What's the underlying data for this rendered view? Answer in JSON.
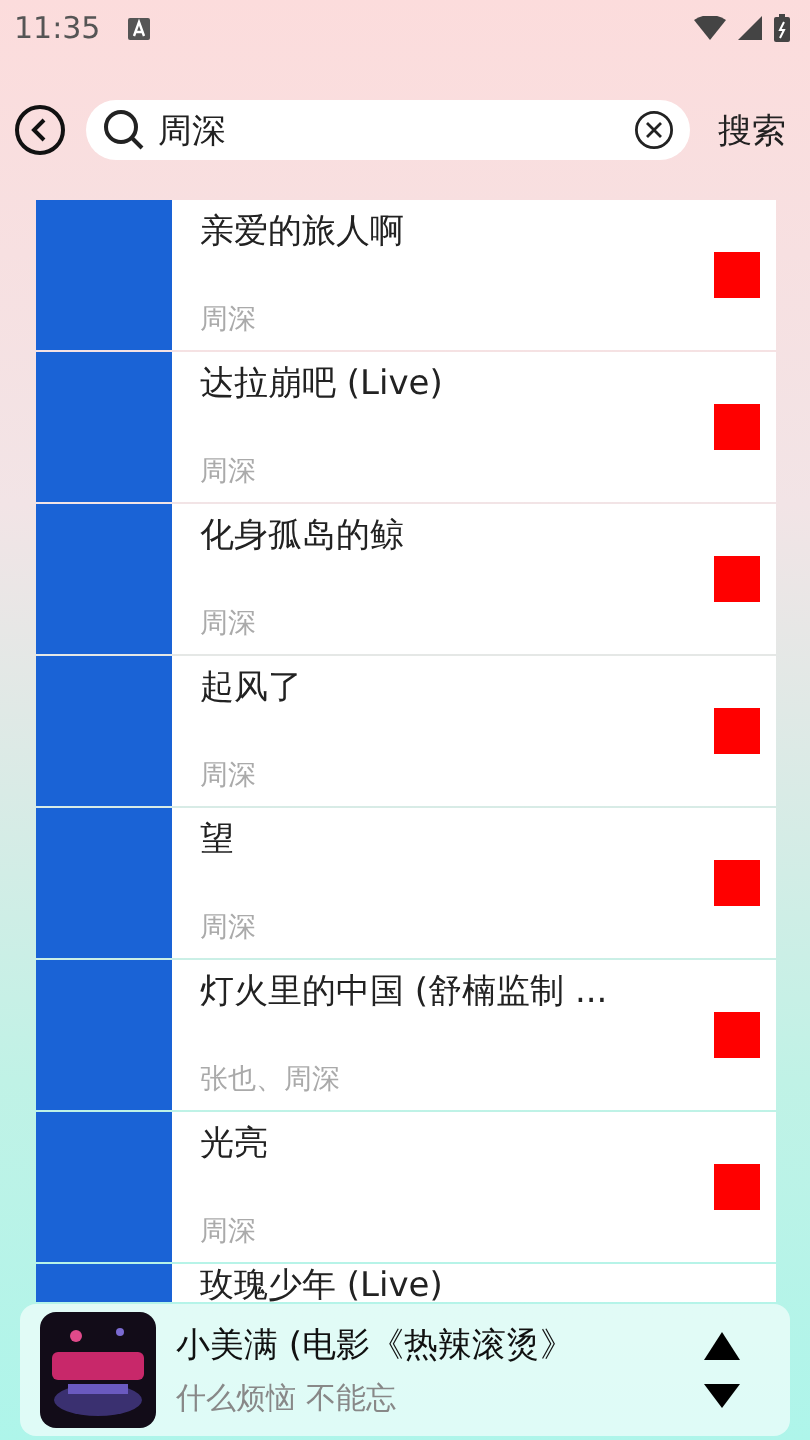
{
  "status_bar": {
    "time": "11:35"
  },
  "search": {
    "value": "周深",
    "button": "搜索"
  },
  "songs": [
    {
      "title": "亲爱的旅人啊",
      "artist": "周深"
    },
    {
      "title": "达拉崩吧 (Live)",
      "artist": "周深"
    },
    {
      "title": "化身孤岛的鲸",
      "artist": "周深"
    },
    {
      "title": "起风了",
      "artist": "周深"
    },
    {
      "title": "望",
      "artist": "周深"
    },
    {
      "title": "灯火里的中国 (舒楠监制 ...",
      "artist": "张也、周深"
    },
    {
      "title": "光亮",
      "artist": "周深"
    },
    {
      "title": "玫瑰少年 (Live)"
    }
  ],
  "player": {
    "title": "小美满 (电影《热辣滚烫》",
    "subtitle": "什么烦恼 不能忘"
  }
}
